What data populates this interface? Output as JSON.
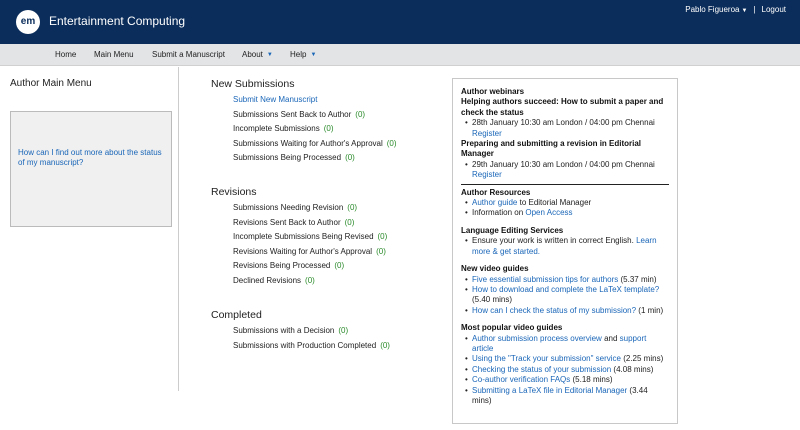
{
  "header": {
    "logo_text": "em",
    "journal_title": "Entertainment Computing",
    "user_name": "Pablo Figueroa",
    "separator": "|",
    "logout_label": "Logout",
    "bg_color": "#0b2d5b"
  },
  "nav": {
    "home": "Home",
    "main_menu": "Main Menu",
    "submit": "Submit a Manuscript",
    "about": "About",
    "help": "Help"
  },
  "left": {
    "heading": "Author Main Menu",
    "help_link": "How can I find out more about the status of my manuscript?"
  },
  "new_submissions": {
    "heading": "New Submissions",
    "items": [
      {
        "label": "Submit New Manuscript",
        "count": ""
      },
      {
        "label": "Submissions Sent Back to Author",
        "count": "(0)"
      },
      {
        "label": "Incomplete Submissions",
        "count": "(0)"
      },
      {
        "label": "Submissions Waiting for Author's Approval",
        "count": "(0)"
      },
      {
        "label": "Submissions Being Processed",
        "count": "(0)"
      }
    ]
  },
  "revisions": {
    "heading": "Revisions",
    "items": [
      {
        "label": "Submissions Needing Revision",
        "count": "(0)"
      },
      {
        "label": "Revisions Sent Back to Author",
        "count": "(0)"
      },
      {
        "label": "Incomplete Submissions Being Revised",
        "count": "(0)"
      },
      {
        "label": "Revisions Waiting for Author's Approval",
        "count": "(0)"
      },
      {
        "label": "Revisions Being Processed",
        "count": "(0)"
      },
      {
        "label": "Declined Revisions",
        "count": "(0)"
      }
    ]
  },
  "completed": {
    "heading": "Completed",
    "items": [
      {
        "label": "Submissions with a Decision",
        "count": "(0)"
      },
      {
        "label": "Submissions with Production Completed",
        "count": "(0)"
      }
    ]
  },
  "panel": {
    "webinars_heading": "Author webinars",
    "webinar1_title": "Helping authors succeed: How to submit a paper and check the status",
    "webinar1_date": "28th January 10:30 am London / 04:00 pm Chennai",
    "webinar1_register": "Register",
    "webinar2_title": "Preparing and submitting a revision in Editorial Manager",
    "webinar2_date": "29th January 10:30 am London / 04:00 pm Chennai",
    "webinar2_register": "Register",
    "resources_heading": "Author Resources",
    "author_guide_link": "Author guide",
    "author_guide_rest": " to Editorial Manager",
    "info_on": "Information on ",
    "open_access_link": "Open Access",
    "lang_heading": "Language Editing Services",
    "lang_text": "Ensure your work is written in correct English. ",
    "lang_link": "Learn more & get started.",
    "video_heading": "New video guides",
    "video1_link": "Five essential submission tips for authors",
    "video1_time": " (5.37 min)",
    "video2_link": "How to download and complete the LaTeX template?",
    "video2_time": " (5.40 mins)",
    "video3_link": "How can I check the status of my submission?",
    "video3_time": " (1 min)",
    "popular_heading": "Most popular video guides",
    "pop1_link": "Author submission process overview",
    "pop1_and": " and ",
    "pop1_link2": "support article",
    "pop2_link": "Using the \"Track your submission\" service",
    "pop2_time": " (2.25 mins)",
    "pop3_link": "Checking the status of your submission",
    "pop3_time": " (4.08 mins)",
    "pop4_link": "Co-author verification FAQs",
    "pop4_time": " (5.18 mins)",
    "pop5_link": "Submitting a LaTeX file in Editorial Manager",
    "pop5_time": " (3.44 mins)"
  }
}
